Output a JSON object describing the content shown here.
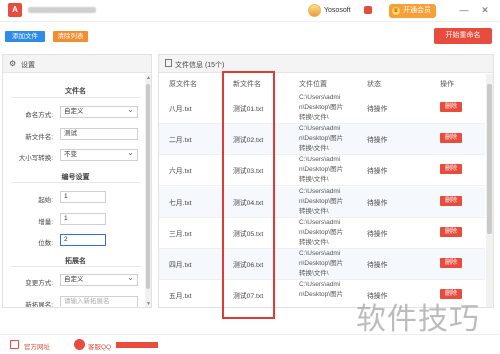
{
  "titlebar": {
    "logo_text": "A",
    "user_name": "Yososoft",
    "vip_label": "开通会员",
    "min_glyph": "—",
    "close_glyph": "✕"
  },
  "toolbar": {
    "add_label": "添加文件",
    "clear_label": "清除列表",
    "start_label": "开始重命名"
  },
  "settings": {
    "header": "设置",
    "section_filename": "文件名",
    "naming_mode_label": "命名方式:",
    "naming_mode_value": "自定义",
    "new_name_label": "新文件名:",
    "new_name_value": "测试",
    "case_label": "大小写转换:",
    "case_value": "不变",
    "section_numbering": "编号设置",
    "start_label": "起始:",
    "start_value": "1",
    "increment_label": "增量:",
    "increment_value": "1",
    "digits_label": "位数:",
    "digits_value": "2",
    "section_extension": "拓展名",
    "ext_mode_label": "变更方式:",
    "ext_mode_value": "自定义",
    "new_ext_label": "新拓展名:",
    "new_ext_placeholder": "请输入新拓展名"
  },
  "files": {
    "header": "文件信息 (15个)",
    "columns": [
      "原文件名",
      "新文件名",
      "文件位置",
      "状态",
      "操作"
    ],
    "rows": [
      {
        "orig": "八月.txt",
        "new": "测试01.txt",
        "loc1": "C:\\Users\\admi",
        "loc2": "n\\Desktop\\图片",
        "loc3": "转换\\文件\\",
        "status": "待操作",
        "action": "删除"
      },
      {
        "orig": "二月.txt",
        "new": "测试02.txt",
        "loc1": "C:\\Users\\admi",
        "loc2": "n\\Desktop\\图片",
        "loc3": "转换\\文件\\",
        "status": "待操作",
        "action": "删除"
      },
      {
        "orig": "六月.txt",
        "new": "测试03.txt",
        "loc1": "C:\\Users\\admi",
        "loc2": "n\\Desktop\\图片",
        "loc3": "转换\\文件\\",
        "status": "待操作",
        "action": "删除"
      },
      {
        "orig": "七月.txt",
        "new": "测试04.txt",
        "loc1": "C:\\Users\\admi",
        "loc2": "n\\Desktop\\图片",
        "loc3": "转换\\文件\\",
        "status": "待操作",
        "action": "删除"
      },
      {
        "orig": "三月.txt",
        "new": "测试05.txt",
        "loc1": "C:\\Users\\admi",
        "loc2": "n\\Desktop\\图片",
        "loc3": "转换\\文件\\",
        "status": "待操作",
        "action": "删除"
      },
      {
        "orig": "四月.txt",
        "new": "测试06.txt",
        "loc1": "C:\\Users\\admi",
        "loc2": "n\\Desktop\\图片",
        "loc3": "转换\\文件\\",
        "status": "待操作",
        "action": "删除"
      },
      {
        "orig": "五月.txt",
        "new": "测试07.txt",
        "loc1": "C:\\Users\\admi",
        "loc2": "n\\Desktop\\图片",
        "loc3": "",
        "status": "待操作",
        "action": "删除"
      }
    ]
  },
  "footer": {
    "site_label": "官方网址",
    "qq_label": "客服QQ"
  },
  "watermark": "软件技巧",
  "colors": {
    "accent_red": "#e84c3d",
    "accent_blue": "#2f8be8",
    "accent_orange": "#f48d2e",
    "highlight_border": "#e03a35"
  }
}
